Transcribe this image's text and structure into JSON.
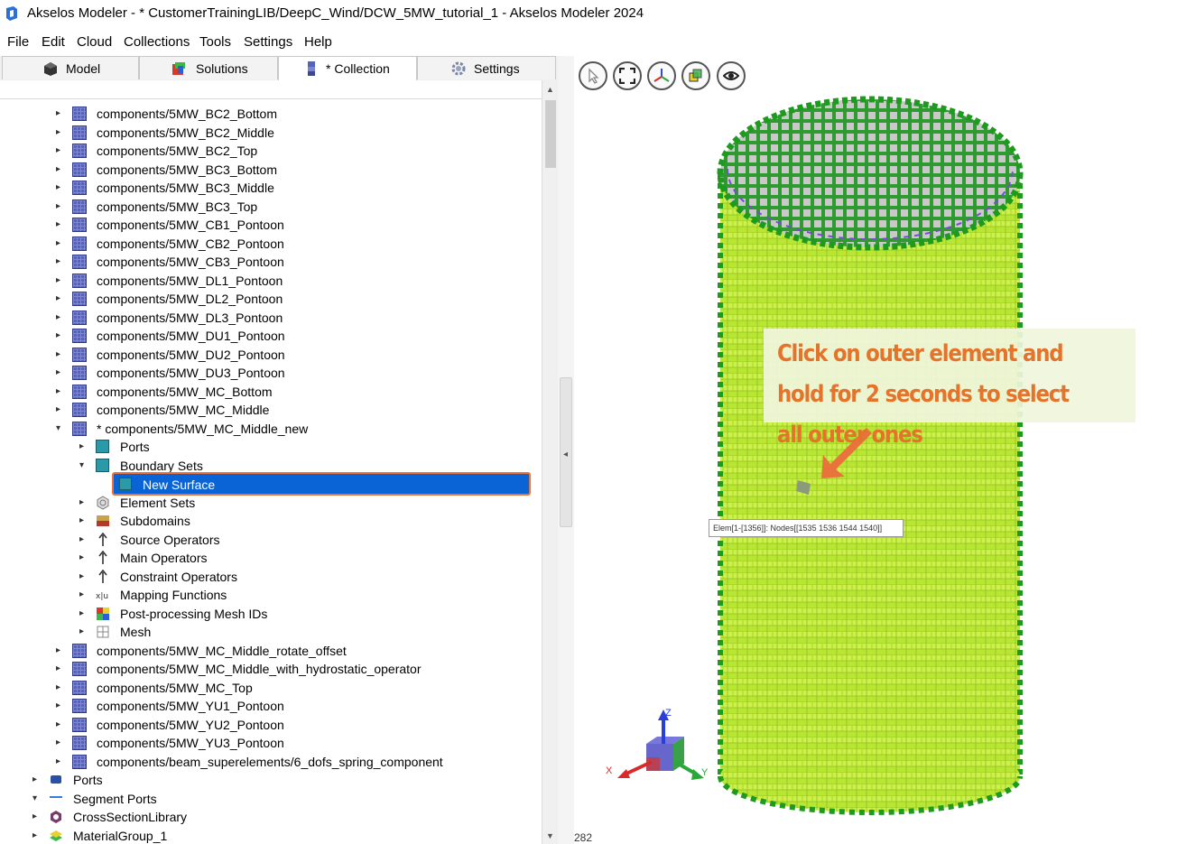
{
  "window": {
    "title": "Akselos Modeler - * CustomerTrainingLIB/DeepC_Wind/DCW_5MW_tutorial_1 - Akselos Modeler 2024"
  },
  "menu": [
    "File",
    "Edit",
    "Cloud",
    "Collections",
    "Tools",
    "Settings",
    "Help"
  ],
  "tabs": [
    "Model",
    "Solutions",
    "* Collection",
    "Settings"
  ],
  "active_tab": "* Collection",
  "tree": {
    "components": [
      "components/5MW_BC2_Bottom",
      "components/5MW_BC2_Middle",
      "components/5MW_BC2_Top",
      "components/5MW_BC3_Bottom",
      "components/5MW_BC3_Middle",
      "components/5MW_BC3_Top",
      "components/5MW_CB1_Pontoon",
      "components/5MW_CB2_Pontoon",
      "components/5MW_CB3_Pontoon",
      "components/5MW_DL1_Pontoon",
      "components/5MW_DL2_Pontoon",
      "components/5MW_DL3_Pontoon",
      "components/5MW_DU1_Pontoon",
      "components/5MW_DU2_Pontoon",
      "components/5MW_DU3_Pontoon",
      "components/5MW_MC_Bottom",
      "components/5MW_MC_Middle"
    ],
    "expanded_component": "* components/5MW_MC_Middle_new",
    "children": {
      "ports": "Ports",
      "boundary_sets": "Boundary Sets",
      "new_surface": "New Surface",
      "element_sets": "Element Sets",
      "subdomains": "Subdomains",
      "source_operators": "Source Operators",
      "main_operators": "Main Operators",
      "constraint_operators": "Constraint Operators",
      "mapping_functions": "Mapping Functions",
      "post_processing": "Post-processing Mesh IDs",
      "mesh": "Mesh"
    },
    "components_after": [
      "components/5MW_MC_Middle_rotate_offset",
      "components/5MW_MC_Middle_with_hydrostatic_operator",
      "components/5MW_MC_Top",
      "components/5MW_YU1_Pontoon",
      "components/5MW_YU2_Pontoon",
      "components/5MW_YU3_Pontoon",
      "components/beam_superelements/6_dofs_spring_component"
    ],
    "root_items": [
      "Ports",
      "Segment Ports",
      "CrossSectionLibrary",
      "MaterialGroup_1"
    ]
  },
  "viewport": {
    "toolbar_icons": [
      "select-icon",
      "fit-view-icon",
      "axes-icon",
      "view-cube-icon",
      "visibility-eye-icon"
    ],
    "callout": "Click on outer element and hold for 2 seconds to select all outer ones",
    "tooltip": "Elem[1-[1356]]: Nodes[[1535 1536 1544 1540]]",
    "axis_labels": {
      "x": "X",
      "y": "Y",
      "z": "Z"
    },
    "coord_readout": "282"
  },
  "colors": {
    "selection": "#0a64d6",
    "highlight_outline": "#e8743b",
    "callout_text": "#e4732b",
    "mesh_fill": "#b8e832",
    "mesh_edge": "#1e9b1e"
  }
}
